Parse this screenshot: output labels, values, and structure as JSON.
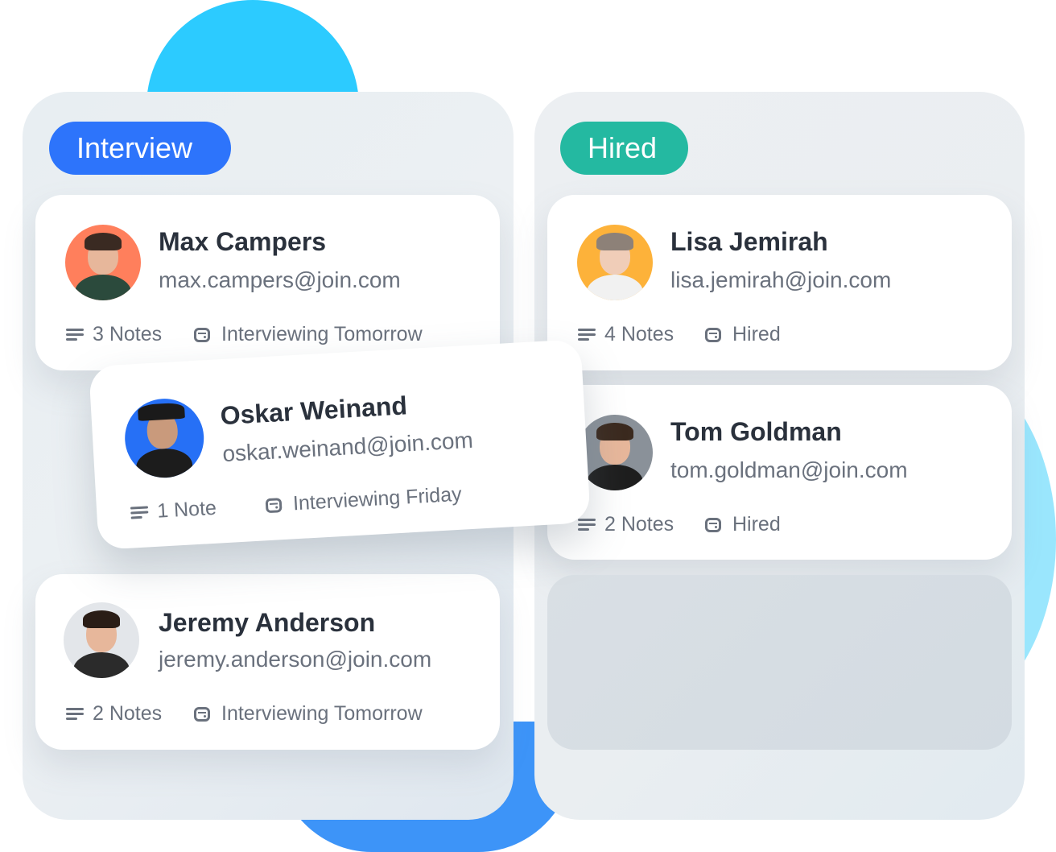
{
  "colors": {
    "interview_badge": "#2d74fb",
    "hired_badge": "#24b9a1",
    "name_text": "#2a313c",
    "secondary_text": "#6a717d",
    "blob_cyan": "#2ccbff",
    "blob_light_cyan": "#9ae6fd",
    "blob_blue": "#3d94f8"
  },
  "columns": [
    {
      "label": "Interview",
      "cards": [
        {
          "name": "Max Campers",
          "email": "max.campers@join.com",
          "notes": "3 Notes",
          "status": "Interviewing Tomorrow",
          "avatar_bg": "#ff7f5c",
          "avatar_icon": "person-photo"
        },
        {
          "name": "Jeremy Anderson",
          "email": "jeremy.anderson@join.com",
          "notes": "2 Notes",
          "status": "Interviewing Tomorrow",
          "avatar_bg": "#e3e6ea",
          "avatar_icon": "person-photo"
        }
      ]
    },
    {
      "label": "Hired",
      "cards": [
        {
          "name": "Lisa Jemirah",
          "email": "lisa.jemirah@join.com",
          "notes": "4 Notes",
          "status": "Hired",
          "avatar_bg": "#fdb23a",
          "avatar_icon": "person-photo"
        },
        {
          "name": "Tom Goldman",
          "email": "tom.goldman@join.com",
          "notes": "2 Notes",
          "status": "Hired",
          "avatar_bg": "#8a9199",
          "avatar_icon": "person-photo"
        }
      ]
    }
  ],
  "dragging_card": {
    "name": "Oskar Weinand",
    "email": "oskar.weinand@join.com",
    "notes": "1 Note",
    "status": "Interviewing Friday",
    "avatar_bg": "#2670f6",
    "avatar_icon": "person-photo"
  },
  "icons": {
    "notes": "notes-lines-icon",
    "status": "status-card-icon"
  }
}
